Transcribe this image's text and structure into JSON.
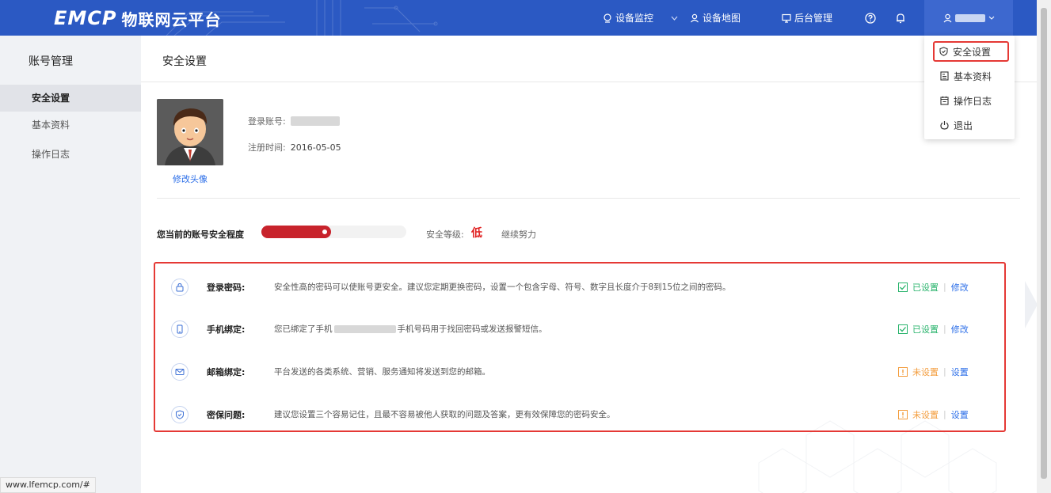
{
  "header": {
    "brand": "EMCP",
    "subtitle": "物联网云平台",
    "nav": [
      {
        "label": "设备监控",
        "icon": "monitor-icon"
      },
      {
        "label": "设备地图",
        "icon": "map-user-icon"
      },
      {
        "label": "后台管理",
        "icon": "screen-icon"
      }
    ],
    "help_icon": "question-circle-icon",
    "bell_icon": "bell-icon",
    "user_icon": "user-icon",
    "chevron_icon": "chevron-down-icon"
  },
  "dropdown": {
    "items": [
      {
        "label": "安全设置",
        "icon": "shield-icon",
        "highlighted": true
      },
      {
        "label": "基本资料",
        "icon": "profile-icon"
      },
      {
        "label": "操作日志",
        "icon": "calendar-icon"
      },
      {
        "label": "退出",
        "icon": "power-icon"
      }
    ]
  },
  "sidebar": {
    "title": "账号管理",
    "items": [
      {
        "label": "安全设置",
        "active": true
      },
      {
        "label": "基本资料"
      },
      {
        "label": "操作日志"
      }
    ]
  },
  "main": {
    "page_title": "安全设置",
    "avatar_link": "修改头像",
    "account_label": "登录账号:",
    "register_label": "注册时间:",
    "register_date": "2016-05-05",
    "level_label": "您当前的账号安全程度",
    "level_fill_percent": 48,
    "safety_grade_label": "安全等级:",
    "safety_grade": "低",
    "encourage": "继续努力"
  },
  "security": {
    "rows": [
      {
        "name": "登录密码:",
        "icon": "lock-icon",
        "desc": "安全性高的密码可以使账号更安全。建议您定期更换密码，设置一个包含字母、符号、数字且长度介于8到15位之间的密码。",
        "status": "已设置",
        "state": "ok",
        "action": "修改"
      },
      {
        "name": "手机绑定:",
        "icon": "phone-icon",
        "desc_prefix": "您已绑定了手机",
        "desc": "手机号码用于找回密码或发送报警短信。",
        "status": "已设置",
        "state": "ok",
        "action": "修改"
      },
      {
        "name": "邮箱绑定:",
        "icon": "mail-icon",
        "desc": "平台发送的各类系统、营销、服务通知将发送到您的邮箱。",
        "status": "未设置",
        "state": "warn",
        "action": "设置"
      },
      {
        "name": "密保问题:",
        "icon": "shield-check-icon",
        "desc": "建议您设置三个容易记住，且最不容易被他人获取的问题及答案，更有效保障您的密码安全。",
        "status": "未设置",
        "state": "warn",
        "action": "设置"
      }
    ]
  },
  "statusbar": {
    "url": "www.lfemcp.com/#"
  },
  "colors": {
    "topbar": "#2b59c3",
    "danger": "#e53935",
    "ok": "#27b36b",
    "warn": "#f39c3c",
    "link": "#2b6ee8"
  }
}
